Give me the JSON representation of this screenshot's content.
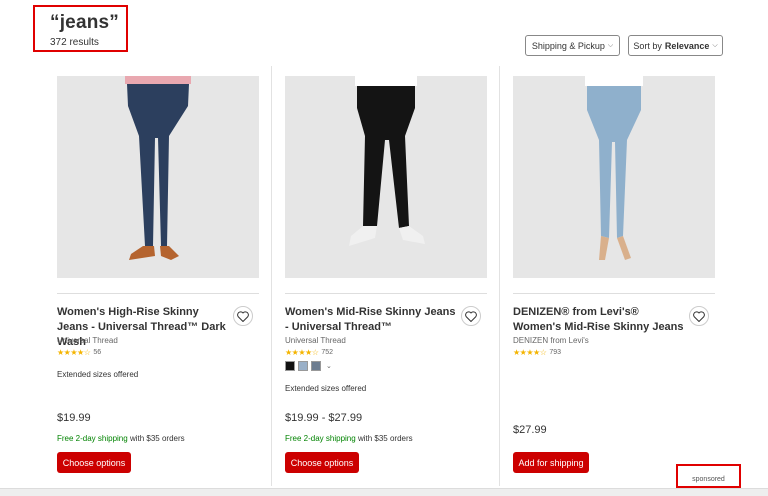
{
  "search": {
    "query": "“jeans”",
    "result_count": "372 results"
  },
  "filters": {
    "shipping_label": "Shipping & Pickup",
    "sort_prefix": "Sort by",
    "sort_value": "Relevance"
  },
  "products": [
    {
      "title": "Women's High-Rise Skinny Jeans - Universal Thread™ Dark Wash",
      "brand": "Universal Thread",
      "stars": "★★★★☆",
      "rating_count": "56",
      "extended": "Extended sizes offered",
      "price": "$19.99",
      "shipping_green": "Free 2-day shipping",
      "shipping_rest": " with $35 orders",
      "cta": "Choose options",
      "jean_color": "#2c3f5e",
      "shoe_color": "#b5642f",
      "top_color": "#e9a8b0"
    },
    {
      "title": "Women's Mid-Rise Skinny Jeans - Universal Thread™",
      "brand": "Universal Thread",
      "stars": "★★★★☆",
      "rating_count": "752",
      "swatch_colors": [
        "#111111",
        "#9ab0c8",
        "#6d7d90"
      ],
      "swatch_more": "⌄",
      "extended": "Extended sizes offered",
      "price": "$19.99 - $27.99",
      "shipping_green": "Free 2-day shipping",
      "shipping_rest": " with $35 orders",
      "cta": "Choose options",
      "jean_color": "#141414",
      "shoe_color": "#f0f0f0",
      "top_color": "#ffffff"
    },
    {
      "title": "DENIZEN® from Levi's® Women's Mid-Rise Skinny Jeans",
      "brand": "DENIZEN from Levi's",
      "stars": "★★★★☆",
      "rating_count": "793",
      "price": "$27.99",
      "cta": "Add for shipping",
      "jean_color": "#8fb0cc",
      "shoe_color": "#d9b08c",
      "top_color": "#ffffff"
    }
  ],
  "sponsored": "sponsored",
  "colors": {
    "accent": "#cc0000",
    "highlight_box": "#e00000",
    "shipping_green": "#008300",
    "star": "#f4b400"
  }
}
